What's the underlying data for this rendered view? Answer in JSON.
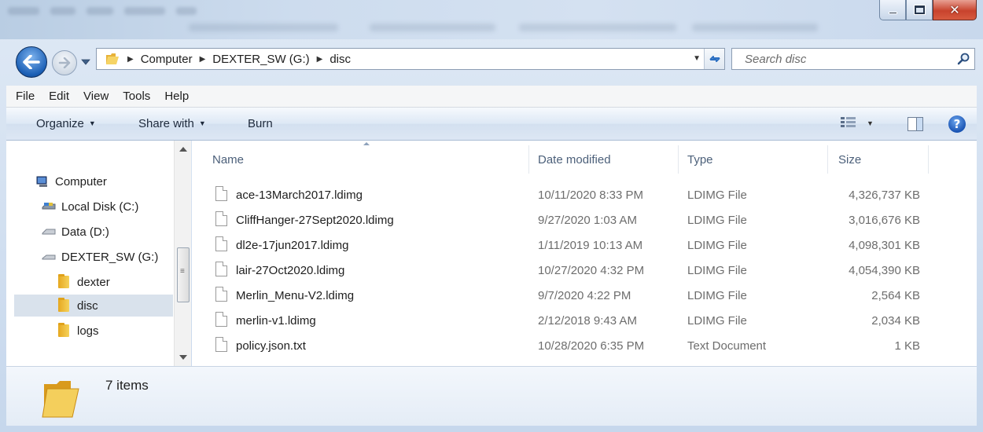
{
  "address": {
    "crumbs": [
      "Computer",
      "DEXTER_SW (G:)",
      "disc"
    ]
  },
  "search": {
    "placeholder": "Search disc"
  },
  "menu": [
    "File",
    "Edit",
    "View",
    "Tools",
    "Help"
  ],
  "toolbar": {
    "organize": "Organize",
    "share_with": "Share with",
    "burn": "Burn"
  },
  "nav": {
    "items": [
      {
        "label": "Computer",
        "icon": "computer-icon"
      },
      {
        "label": "Local Disk (C:)",
        "icon": "local-disk-icon"
      },
      {
        "label": "Data (D:)",
        "icon": "drive-icon"
      },
      {
        "label": "DEXTER_SW (G:)",
        "icon": "drive-icon"
      },
      {
        "label": "dexter",
        "icon": "folder-icon"
      },
      {
        "label": "disc",
        "icon": "folder-icon",
        "selected": true
      },
      {
        "label": "logs",
        "icon": "folder-icon"
      }
    ]
  },
  "columns": {
    "name": "Name",
    "date": "Date modified",
    "type": "Type",
    "size": "Size"
  },
  "files": [
    {
      "name": "ace-13March2017.ldimg",
      "date": "10/11/2020 8:33 PM",
      "type": "LDIMG File",
      "size": "4,326,737 KB"
    },
    {
      "name": "CliffHanger-27Sept2020.ldimg",
      "date": "9/27/2020 1:03 AM",
      "type": "LDIMG File",
      "size": "3,016,676 KB"
    },
    {
      "name": "dl2e-17jun2017.ldimg",
      "date": "1/11/2019 10:13 AM",
      "type": "LDIMG File",
      "size": "4,098,301 KB"
    },
    {
      "name": "lair-27Oct2020.ldimg",
      "date": "10/27/2020 4:32 PM",
      "type": "LDIMG File",
      "size": "4,054,390 KB"
    },
    {
      "name": "Merlin_Menu-V2.ldimg",
      "date": "9/7/2020 4:22 PM",
      "type": "LDIMG File",
      "size": "2,564 KB"
    },
    {
      "name": "merlin-v1.ldimg",
      "date": "2/12/2018 9:43 AM",
      "type": "LDIMG File",
      "size": "2,034 KB"
    },
    {
      "name": "policy.json.txt",
      "date": "10/28/2020 6:35 PM",
      "type": "Text Document",
      "size": "1 KB"
    }
  ],
  "status": {
    "item_count": "7 items"
  }
}
